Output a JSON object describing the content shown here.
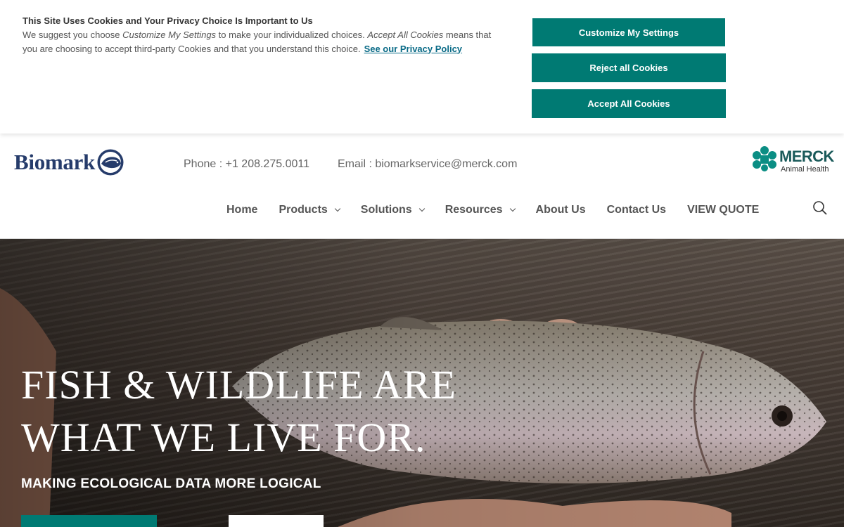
{
  "cookie_banner": {
    "title": "This Site Uses Cookies and Your Privacy Choice Is Important to Us",
    "body_part1": "We suggest you choose ",
    "body_em1": "Customize My Settings",
    "body_part2": " to make your individualized choices. ",
    "body_em2": "Accept All Cookies",
    "body_part3": " means that you are choosing to accept third-party Cookies and that you understand this choice.",
    "privacy_link": "See our Privacy Policy",
    "buttons": {
      "customize": "Customize My Settings",
      "reject": "Reject all Cookies",
      "accept": "Accept All Cookies"
    },
    "accent_color": "#007a73"
  },
  "header": {
    "logo_text": "Biomark",
    "phone": "Phone : +1 208.275.0011",
    "email": "Email : biomarkservice@merck.com",
    "partner": {
      "name": "MERCK",
      "sub": "Animal Health"
    }
  },
  "nav": {
    "items": [
      {
        "label": "Home"
      },
      {
        "label": "Products"
      },
      {
        "label": "Solutions"
      },
      {
        "label": "Resources"
      },
      {
        "label": "About Us"
      },
      {
        "label": "Contact Us"
      },
      {
        "label": "VIEW QUOTE"
      }
    ],
    "search_icon": "search-icon"
  },
  "hero": {
    "title_line1": "FISH & WILDLIFE ARE",
    "title_line2": "WHAT WE LIVE FOR.",
    "subtitle": "MAKING ECOLOGICAL DATA MORE LOGICAL"
  }
}
